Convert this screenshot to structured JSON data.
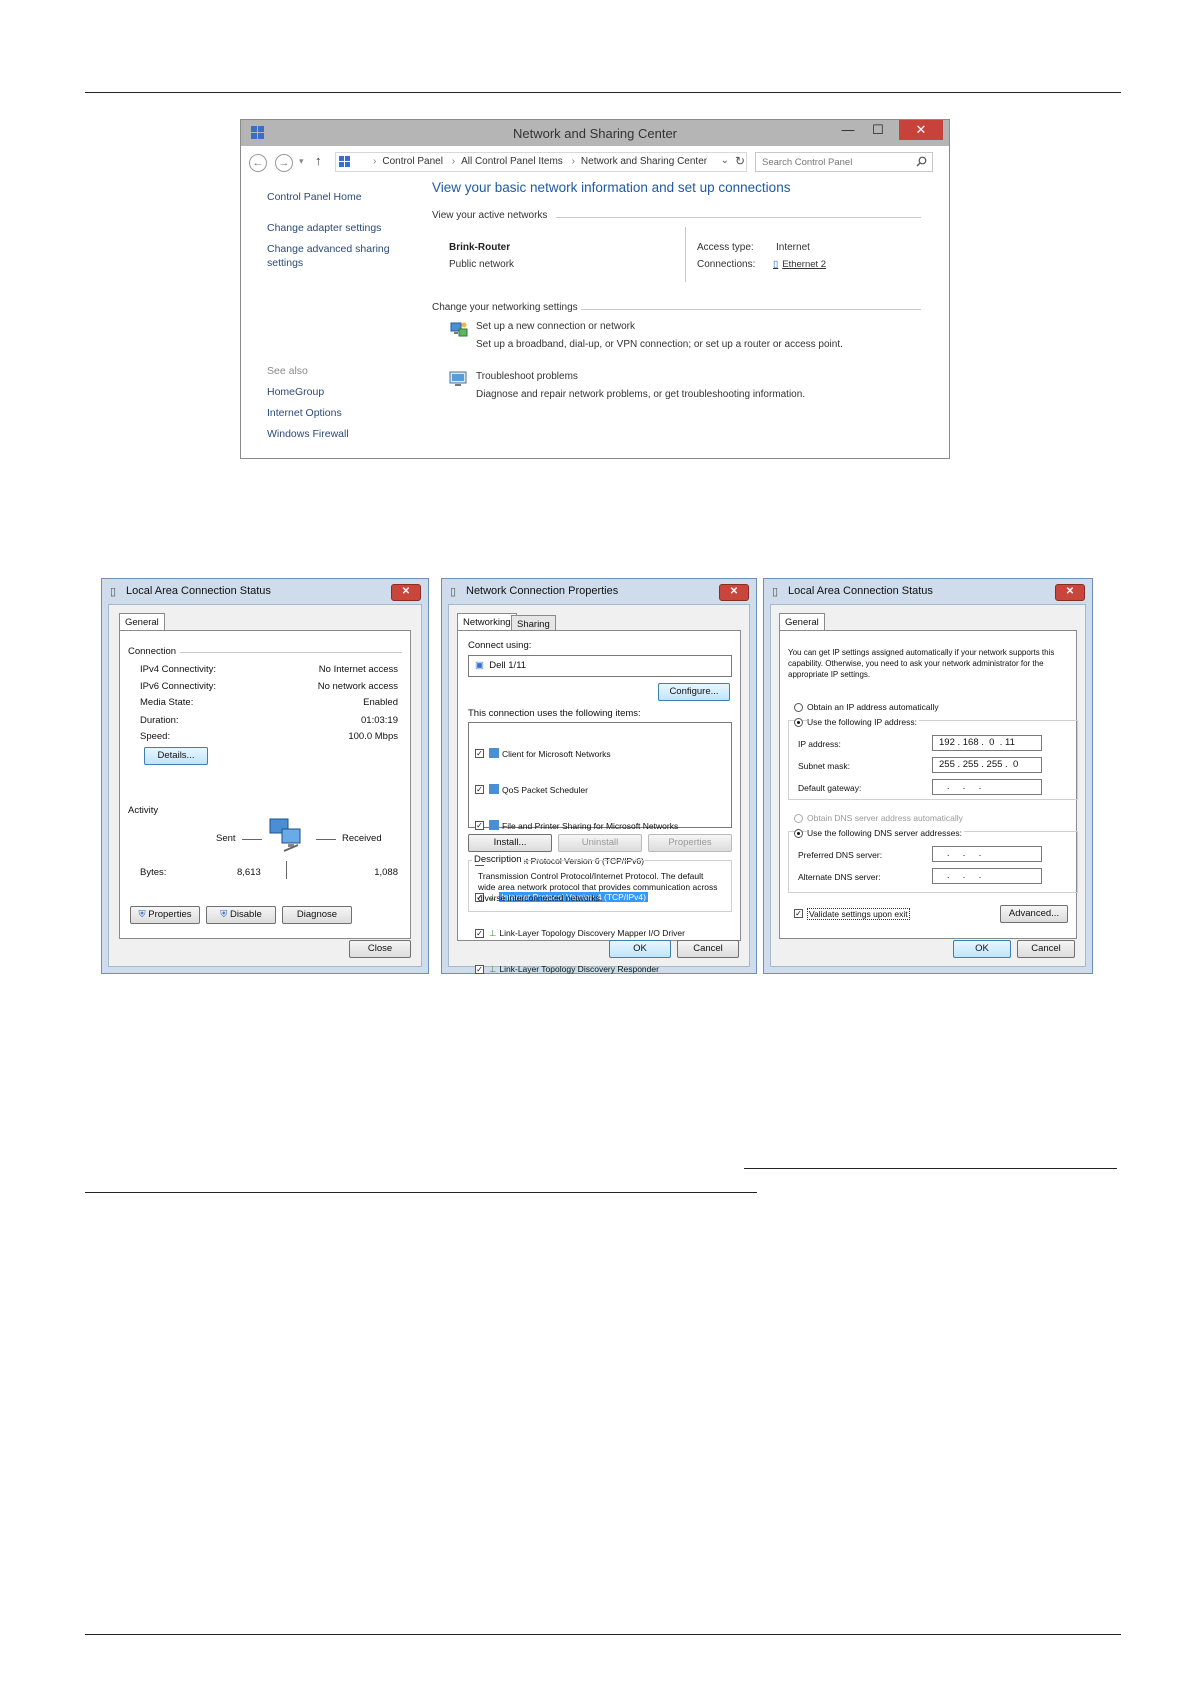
{
  "win8": {
    "title": "Network and Sharing Center",
    "controls": {
      "minimize": "—",
      "maximize": "☐",
      "close": "✕"
    },
    "breadcrumbs": [
      "Control Panel",
      "All Control Panel Items",
      "Network and Sharing Center"
    ],
    "search_placeholder": "Search Control Panel",
    "sidebar": {
      "home": "Control Panel Home",
      "adapter": "Change adapter settings",
      "advanced_1": "Change advanced sharing",
      "advanced_2": "settings",
      "see_also": "See also",
      "homegroup": "HomeGroup",
      "internet_options": "Internet Options",
      "firewall": "Windows Firewall"
    },
    "heading": "View your basic network information and set up connections",
    "active_networks_label": "View your active networks",
    "network_name": "Brink-Router",
    "network_type": "Public network",
    "access_type_label": "Access type:",
    "access_type_value": "Internet",
    "connections_label": "Connections:",
    "connections_value": "Ethernet 2",
    "change_settings_label": "Change your networking settings",
    "setup_link": "Set up a new connection or network",
    "setup_desc": "Set up a broadband, dial-up, or VPN connection; or set up a router or access point.",
    "troubleshoot_link": "Troubleshoot problems",
    "troubleshoot_desc": "Diagnose and repair network problems, or get troubleshooting information."
  },
  "status1": {
    "title": "Local Area Connection Status",
    "tab": "General",
    "connection_label": "Connection",
    "rows": [
      {
        "label": "IPv4 Connectivity:",
        "value": "No Internet access"
      },
      {
        "label": "IPv6 Connectivity:",
        "value": "No network access"
      },
      {
        "label": "Media State:",
        "value": "Enabled"
      },
      {
        "label": "Duration:",
        "value": "01:03:19"
      },
      {
        "label": "Speed:",
        "value": "100.0 Mbps"
      }
    ],
    "details_button": "Details...",
    "activity_label": "Activity",
    "sent": "Sent",
    "received": "Received",
    "bytes_label": "Bytes:",
    "bytes_sent": "8,613",
    "bytes_received": "1,088",
    "properties_button": "Properties",
    "disable_button": "Disable",
    "diagnose_button": "Diagnose",
    "close_button": "Close"
  },
  "props": {
    "title": "Network Connection Properties",
    "tab_networking": "Networking",
    "tab_sharing": "Sharing",
    "connect_using": "Connect using:",
    "adapter": "Dell 1/11",
    "configure_button": "Configure...",
    "items_label": "This connection uses the following items:",
    "items": [
      "Client for Microsoft Networks",
      "QoS Packet Scheduler",
      "File and Printer Sharing for Microsoft Networks",
      "Internet Protocol Version 6 (TCP/IPv6)",
      "Internet Protocol Version 4 (TCP/IPv4)",
      "Link-Layer Topology Discovery Mapper I/O Driver",
      "Link-Layer Topology Discovery Responder"
    ],
    "install_button": "Install...",
    "uninstall_button": "Uninstall",
    "properties_button": "Properties",
    "description_label": "Description",
    "description": "Transmission Control Protocol/Internet Protocol. The default wide area network protocol that provides communication across diverse interconnected networks.",
    "ok_button": "OK",
    "cancel_button": "Cancel"
  },
  "ipv4": {
    "title": "Local Area Connection Status",
    "tab": "General",
    "intro": "You can get IP settings assigned automatically if your network supports this capability. Otherwise, you need to ask your network administrator for the appropriate IP settings.",
    "obtain_ip": "Obtain an IP address automatically",
    "use_ip": "Use the following IP address:",
    "ip_label": "IP address:",
    "ip_value": "192 . 168 .  0  . 11",
    "mask_label": "Subnet mask:",
    "mask_value": "255 . 255 . 255 .  0",
    "gateway_label": "Default gateway:",
    "gateway_value": "   .     .     .",
    "obtain_dns": "Obtain DNS server address automatically",
    "use_dns": "Use the following DNS server addresses:",
    "pref_dns_label": "Preferred DNS server:",
    "pref_dns_value": "   .     .     .",
    "alt_dns_label": "Alternate DNS server:",
    "alt_dns_value": "   .     .     .",
    "validate": "Validate settings upon exit",
    "advanced_button": "Advanced...",
    "ok_button": "OK",
    "cancel_button": "Cancel"
  }
}
